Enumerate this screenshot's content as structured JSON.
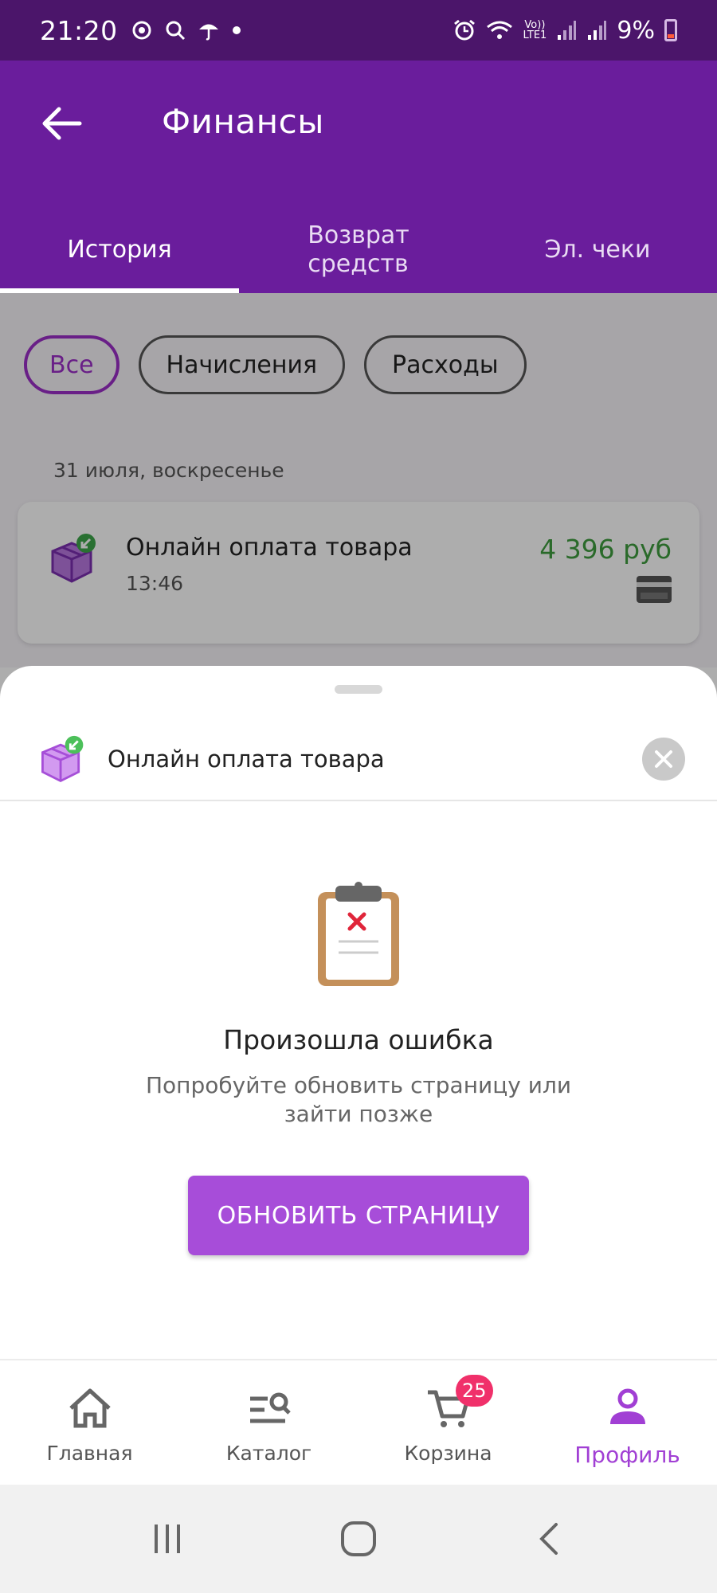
{
  "status_bar": {
    "time": "21:20",
    "left_icons": [
      "sync-icon",
      "search-icon",
      "umbrella-icon",
      "dot-icon"
    ],
    "right_icons": [
      "alarm-icon",
      "wifi-icon",
      "volte-icon",
      "signal-icon",
      "signal-icon"
    ],
    "volte_label": "Vo)) LTE1",
    "battery": "9%"
  },
  "header": {
    "title": "Финансы",
    "tabs": [
      {
        "label": "История",
        "active": true
      },
      {
        "label": "Возврат\nсредств",
        "active": false
      },
      {
        "label": "Эл. чеки",
        "active": false
      }
    ]
  },
  "filters": {
    "chips": [
      {
        "label": "Все",
        "active": true
      },
      {
        "label": "Начисления",
        "active": false
      },
      {
        "label": "Расходы",
        "active": false
      }
    ]
  },
  "history": {
    "date": "31 июля, воскресенье",
    "transaction": {
      "name": "Онлайн оплата товара",
      "time": "13:46",
      "amount": "4 396 руб",
      "icon": "package-in-icon",
      "payment_icon": "credit-card-icon"
    }
  },
  "sheet": {
    "title": "Онлайн оплата товара",
    "error_title": "Произошла ошибка",
    "error_text": "Попробуйте обновить страницу или зайти позже",
    "button_label": "ОБНОВИТЬ СТРАНИЦУ"
  },
  "bottom_nav": {
    "items": [
      {
        "label": "Главная",
        "icon": "home-icon",
        "active": false
      },
      {
        "label": "Каталог",
        "icon": "catalog-search-icon",
        "active": false
      },
      {
        "label": "Корзина",
        "icon": "cart-icon",
        "active": false,
        "badge": "25"
      },
      {
        "label": "Профиль",
        "icon": "profile-icon",
        "active": true
      }
    ]
  },
  "colors": {
    "header": "#6a1d9c",
    "status_bar": "#4b156a",
    "accent": "#a74dd9",
    "amount": "#3f9c3f",
    "badge": "#f0306a"
  }
}
